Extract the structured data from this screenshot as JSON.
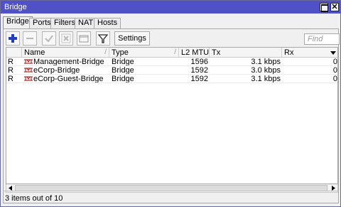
{
  "window": {
    "title": "Bridge"
  },
  "tabs": [
    {
      "label": "Bridge",
      "active": true
    },
    {
      "label": "Ports",
      "active": false
    },
    {
      "label": "Filters",
      "active": false
    },
    {
      "label": "NAT",
      "active": false
    },
    {
      "label": "Hosts",
      "active": false
    }
  ],
  "toolbar": {
    "add_icon": "plus-icon",
    "remove_icon": "minus-icon",
    "enable_icon": "check-icon",
    "disable_icon": "x-icon",
    "comment_icon": "comment-icon",
    "filter_icon": "filter-icon",
    "settings_label": "Settings",
    "find_placeholder": "Find"
  },
  "table": {
    "columns": [
      "Name",
      "Type",
      "L2 MTU",
      "Tx",
      "Rx"
    ],
    "rows": [
      {
        "flag": "R",
        "name": "Management-Bridge",
        "type": "Bridge",
        "l2mtu": "1596",
        "tx": "3.1 kbps",
        "rx": "0"
      },
      {
        "flag": "R",
        "name": "eCorp-Bridge",
        "type": "Bridge",
        "l2mtu": "1592",
        "tx": "3.0 kbps",
        "rx": "0"
      },
      {
        "flag": "R",
        "name": "eCorp-Guest-Bridge",
        "type": "Bridge",
        "l2mtu": "1592",
        "tx": "3.1 kbps",
        "rx": "0"
      }
    ]
  },
  "status": {
    "text": "3 items out of 10"
  },
  "colors": {
    "titlebar": "#5151c7",
    "add_blue": "#1f3fbf",
    "bridge_icon_red": "#b03030"
  }
}
